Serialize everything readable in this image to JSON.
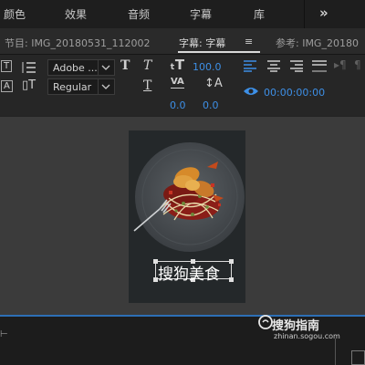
{
  "top_tabs": [
    "颜色",
    "效果",
    "音频",
    "字幕",
    "库"
  ],
  "more_label": "»",
  "panel": {
    "program_label": "节目: IMG_20180531_112002",
    "caption_tab": "字幕: 字幕",
    "menu_icon": "≡",
    "reference_label": "参考: IMG_20180"
  },
  "font": {
    "family": "Adobe ...",
    "style": "Regular"
  },
  "values": {
    "size": "100.0",
    "tracking": "0.0",
    "leading": "0.0",
    "timecode": "00:00:00:00"
  },
  "caption_text": "搜狗美食",
  "watermark": {
    "brand": "搜狗指南",
    "url": "zhinan.sogou.com"
  },
  "icons": [
    "text-tool-icon",
    "line-spacing-icon",
    "bold-icon",
    "italic-icon",
    "text-size-icon",
    "tracking-icon",
    "underline-icon",
    "leading-icon",
    "align-left-icon",
    "align-center-icon",
    "align-right-icon",
    "justify-icon",
    "eye-icon"
  ],
  "colors": {
    "accent": "#3d8fe6",
    "background": "#232323"
  }
}
